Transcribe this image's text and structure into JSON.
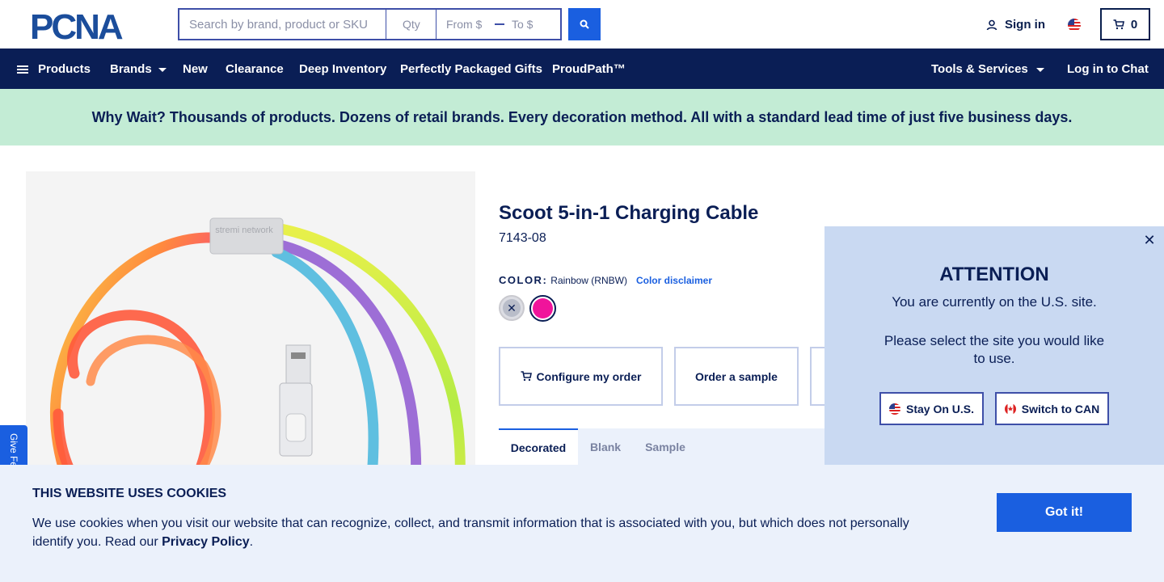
{
  "header": {
    "logo_text": "PCNA",
    "search_placeholder": "Search by brand, product or SKU",
    "qty_placeholder": "Qty",
    "price_from_placeholder": "From $",
    "price_to_placeholder": "To $",
    "sign_in": "Sign in",
    "cart_count": "0"
  },
  "nav": {
    "items": [
      {
        "label": "Products"
      },
      {
        "label": "Brands"
      },
      {
        "label": "New"
      },
      {
        "label": "Clearance"
      },
      {
        "label": "Deep Inventory"
      },
      {
        "label": "Perfectly Packaged Gifts"
      },
      {
        "label": "ProudPath™"
      },
      {
        "label": "Tools & Services"
      },
      {
        "label": "Log in to Chat"
      }
    ]
  },
  "promo": {
    "text": "Why Wait? Thousands of products. Dozens of retail brands. Every decoration method. All with a standard lead time of just five business days."
  },
  "product": {
    "title": "Scoot 5-in-1 Charging Cable",
    "sku": "7143-08",
    "color_label": "COLOR:",
    "color_value": "Rainbow (RNBW)",
    "color_disclaimer": "Color disclaimer",
    "image_brand_text": "stremi network",
    "swatch_selected_color": "#f0149b",
    "actions": {
      "configure": "Configure my order",
      "sample": "Order a sample"
    },
    "tabs": [
      {
        "label": "Decorated"
      },
      {
        "label": "Blank"
      },
      {
        "label": "Sample"
      }
    ]
  },
  "region_popup": {
    "title": "ATTENTION",
    "message": "You are currently on the U.S. site.",
    "prompt": "Please select the site you would like to use.",
    "stay_button": "Stay On U.S.",
    "switch_button": "Switch to CAN"
  },
  "feedback": {
    "label": "Give Feedback"
  },
  "cookie": {
    "title": "THIS WEBSITE USES COOKIES",
    "text": "We use cookies when you visit our website that can recognize, collect, and transmit information that is associated with you, but which does not personally identify you. Read our",
    "link": "Privacy Policy",
    "period": ".",
    "button": "Got it!"
  },
  "colors": {
    "navy": "#0a1e55",
    "accent_blue": "#1a5fe0",
    "promo_green": "#c3ecd5",
    "popup_bg": "#c9d9f2",
    "cookie_bg": "#ebf1fb"
  }
}
